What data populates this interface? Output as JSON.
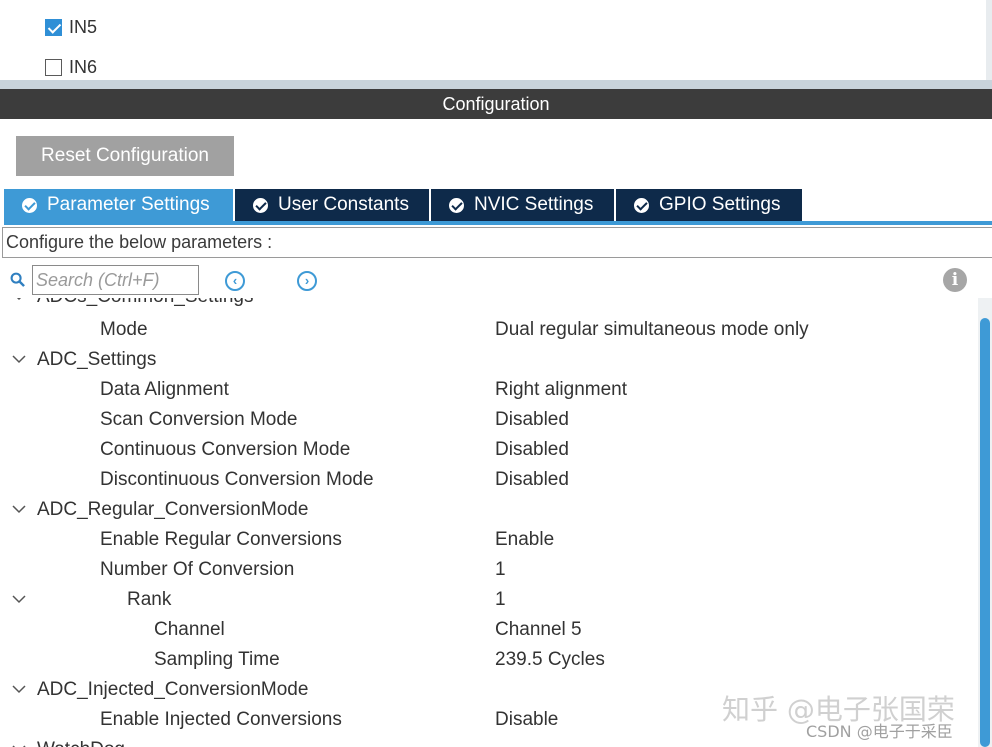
{
  "channels": [
    {
      "label": "IN5",
      "checked": true
    },
    {
      "label": "IN6",
      "checked": false
    }
  ],
  "header": {
    "title": "Configuration"
  },
  "reset_button": "Reset Configuration",
  "tabs": [
    {
      "label": "Parameter Settings",
      "active": true
    },
    {
      "label": "User Constants",
      "active": false
    },
    {
      "label": "NVIC Settings",
      "active": false
    },
    {
      "label": "GPIO Settings",
      "active": false
    }
  ],
  "description": "Configure the below parameters :",
  "search": {
    "placeholder": "Search (Ctrl+F)"
  },
  "tree": [
    {
      "label": "ADCs_Common_Settings",
      "value": "",
      "group": true
    },
    {
      "label": "Mode",
      "value": "Dual regular simultaneous mode only"
    },
    {
      "label": "ADC_Settings",
      "value": "",
      "group": true
    },
    {
      "label": "Data Alignment",
      "value": "Right alignment"
    },
    {
      "label": "Scan Conversion Mode",
      "value": "Disabled"
    },
    {
      "label": "Continuous Conversion Mode",
      "value": "Disabled"
    },
    {
      "label": "Discontinuous Conversion Mode",
      "value": "Disabled"
    },
    {
      "label": "ADC_Regular_ConversionMode",
      "value": "",
      "group": true
    },
    {
      "label": "Enable Regular Conversions",
      "value": "Enable"
    },
    {
      "label": "Number Of Conversion",
      "value": "1"
    },
    {
      "label": "Rank",
      "value": "1",
      "group": true
    },
    {
      "label": "Channel",
      "value": "Channel 5"
    },
    {
      "label": "Sampling Time",
      "value": "239.5 Cycles"
    },
    {
      "label": "ADC_Injected_ConversionMode",
      "value": "",
      "group": true
    },
    {
      "label": "Enable Injected Conversions",
      "value": "Disable"
    },
    {
      "label": "WatchDog",
      "value": "",
      "group": true
    }
  ],
  "watermark": {
    "main": "知乎 @电子张国荣",
    "sub": "CSDN @电子于采臣"
  },
  "colors": {
    "accent": "#3e9ad6",
    "tab_dark": "#0e2a4a",
    "header": "#3c3c3c",
    "button": "#a1a1a1"
  }
}
